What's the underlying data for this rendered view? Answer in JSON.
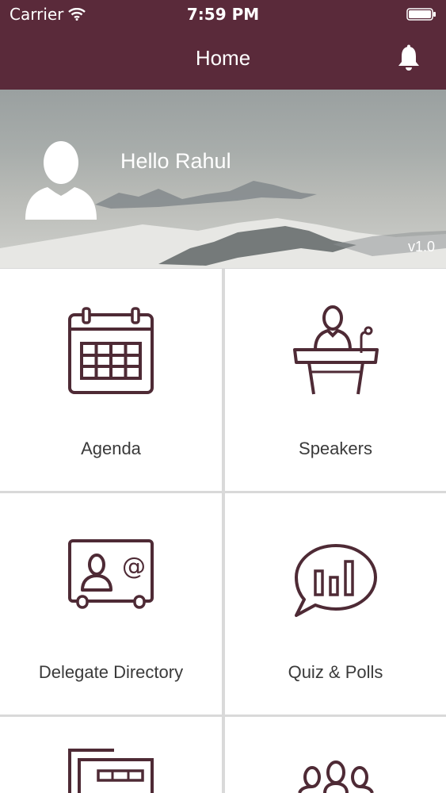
{
  "status_bar": {
    "carrier": "Carrier",
    "time": "7:59 PM"
  },
  "nav": {
    "title": "Home",
    "icon": "bell-icon"
  },
  "hero": {
    "greeting": "Hello Rahul",
    "version": "v1.0"
  },
  "colors": {
    "brand": "#5a2a3a",
    "icon_stroke": "#4e2a35",
    "divider": "#d9d9d9"
  },
  "menu": [
    {
      "label": "Agenda",
      "icon": "calendar-icon"
    },
    {
      "label": "Speakers",
      "icon": "podium-speaker-icon"
    },
    {
      "label": "Delegate Directory",
      "icon": "contact-card-icon"
    },
    {
      "label": "Quiz & Polls",
      "icon": "poll-bubble-icon"
    },
    {
      "label": "",
      "icon": "documents-icon"
    },
    {
      "label": "",
      "icon": "group-icon"
    }
  ]
}
